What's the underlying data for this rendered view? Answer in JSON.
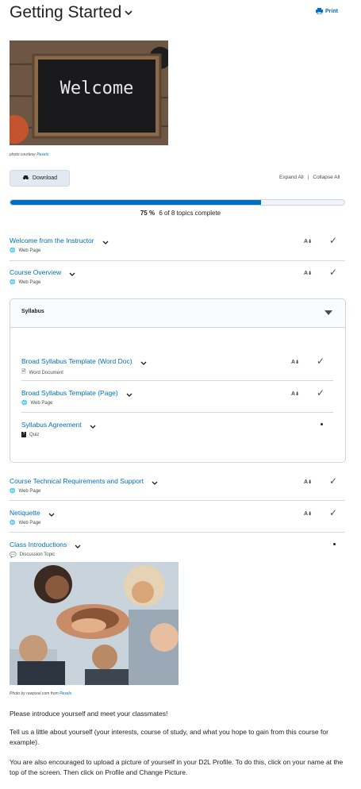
{
  "page": {
    "title": "Getting Started",
    "print_label": "Print"
  },
  "hero": {
    "board_text": "Welcome",
    "caption_prefix": "photo courtesy ",
    "caption_link": "Pexels"
  },
  "toolbar": {
    "download_label": "Download",
    "expand_all": "Expand All",
    "separator": "|",
    "collapse_all": "Collapse All"
  },
  "progress": {
    "percent_label": "75 %",
    "fraction": 0.75,
    "summary": "6 of 8 topics complete"
  },
  "topics": [
    {
      "title": "Welcome from the Instructor",
      "type": "Web Page",
      "type_icon": "globe-icon",
      "status": "complete"
    },
    {
      "title": "Course Overview",
      "type": "Web Page",
      "type_icon": "globe-icon",
      "status": "complete"
    }
  ],
  "module": {
    "title": "Syllabus",
    "topics": [
      {
        "title": "Broad Syllabus Template (Word Doc)",
        "type": "Word Document",
        "type_icon": "document-icon",
        "status": "complete"
      },
      {
        "title": "Broad Syllabus Template (Page)",
        "type": "Web Page",
        "type_icon": "globe-icon",
        "status": "complete"
      },
      {
        "title": "Syllabus Agreement",
        "type": "Quiz",
        "type_icon": "quiz-icon",
        "status": "incomplete"
      }
    ]
  },
  "topics_after": [
    {
      "title": "Course Technical Requirements and Support",
      "type": "Web Page",
      "type_icon": "globe-icon",
      "status": "complete"
    },
    {
      "title": "Netiquette",
      "type": "Web Page",
      "type_icon": "globe-icon",
      "status": "complete"
    },
    {
      "title": "Class Introductions",
      "type": "Discussion Topic",
      "type_icon": "discussion-icon",
      "status": "incomplete"
    }
  ],
  "intro": {
    "photo_caption_prefix": "Photo by rawpixel.com from ",
    "photo_caption_link": "Pexels",
    "paragraph1": "Please introduce yourself and meet your classmates!",
    "paragraph2": "Tell us a little about yourself (your interests, course of study, and what you hope to gain from this course for example).",
    "paragraph3": "You are also encouraged to upload a picture of yourself in your D2L Profile. To do this, click on your name at the top of the screen. Then click on Profile and Change Picture."
  },
  "colors": {
    "link": "#006fbf",
    "progress_fill": "#006fbf",
    "text": "#202122"
  }
}
